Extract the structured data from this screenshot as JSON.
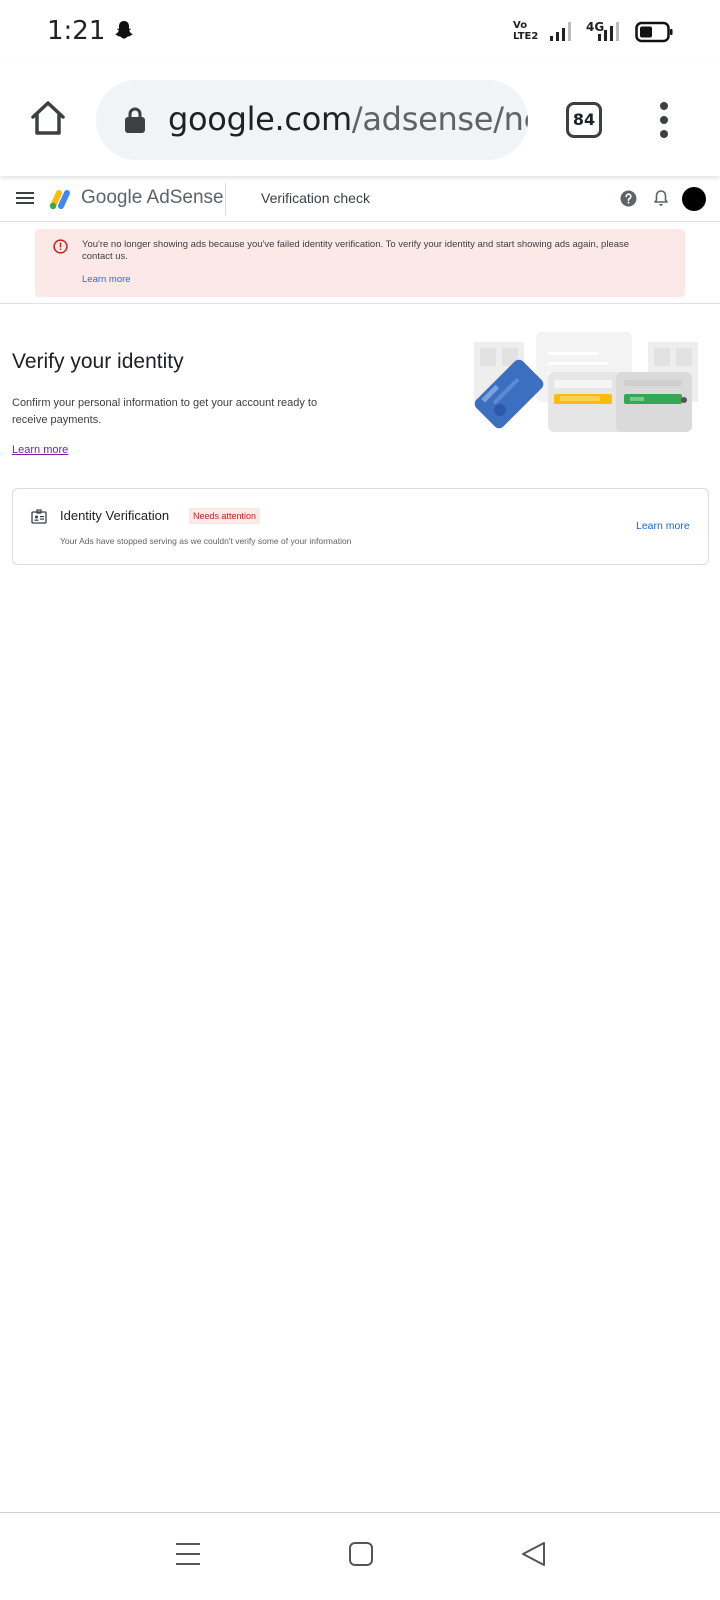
{
  "status_bar": {
    "time": "1:21",
    "volte_label": "VoLTE2",
    "network": "4G"
  },
  "browser": {
    "url_domain": "google.com",
    "url_path": "/adsense/ne",
    "tab_count": "84"
  },
  "header": {
    "brand_google": "Google",
    "brand_product": "AdSense",
    "page_title": "Verification check"
  },
  "alert": {
    "message": "You're no longer showing ads because you've failed identity verification. To verify your identity and start showing ads again, please contact us.",
    "link": "Learn more"
  },
  "verify": {
    "title": "Verify your identity",
    "description": "Confirm your personal information to get your account ready to receive payments.",
    "link": "Learn more"
  },
  "card": {
    "title": "Identity Verification",
    "badge": "Needs attention",
    "description": "Your Ads have stopped serving as we couldn't verify some of your information",
    "link": "Learn more"
  },
  "colors": {
    "alert_bg": "#fce8e6",
    "alert_icon": "#c5221f",
    "link_blue": "#1a73e8",
    "visited_link": "#7b1fa2",
    "badge_text": "#c5221f"
  }
}
